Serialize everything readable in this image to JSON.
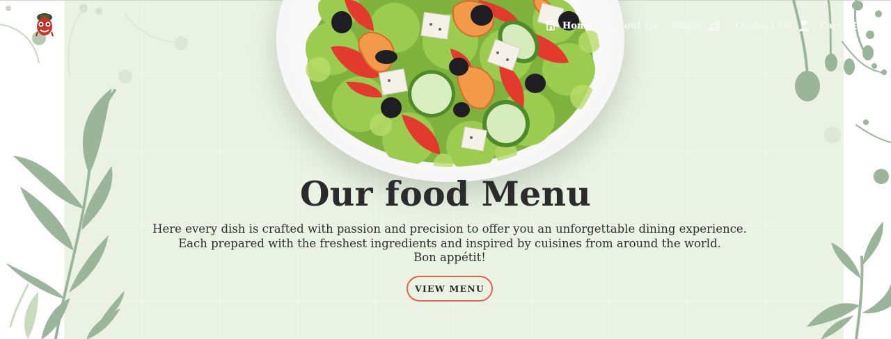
{
  "brand": {
    "logo_icon": "chef-logo-icon"
  },
  "nav": {
    "items": [
      {
        "label": "Home",
        "icon": "store-icon"
      },
      {
        "label": "About Us",
        "icon": ""
      },
      {
        "label": "Meals",
        "icon": "food-tray-icon"
      },
      {
        "label": "Contact US",
        "icon": "user-icon"
      },
      {
        "label": "Cart",
        "icon": "cart-icon"
      }
    ],
    "active": "Home"
  },
  "hero": {
    "title": "Our food Menu",
    "description_lines": [
      "Here every dish is crafted with passion and precision to offer you an unforgettable dining experience.",
      "Each prepared with the freshest ingredients and inspired by cuisines from around the world.",
      "Bon appétit!"
    ],
    "cta_label": "VIEW MENU"
  },
  "colors": {
    "hero_background": "#eaf3e3",
    "leaf": "#9bb59a",
    "title": "#2b2b2b",
    "cta_border": "#e2614d"
  }
}
